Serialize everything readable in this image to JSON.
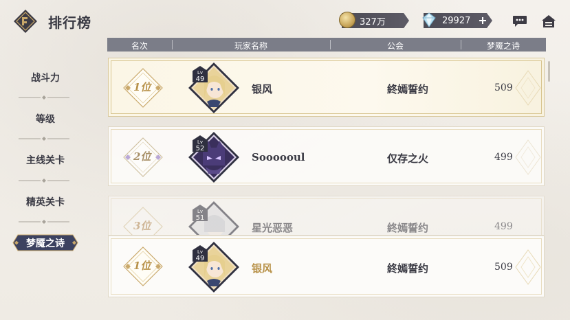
{
  "header": {
    "title": "排行榜",
    "gold_amount": "327万",
    "gem_amount": "29927"
  },
  "nav": {
    "items": [
      {
        "label": "战斗力"
      },
      {
        "label": "等级"
      },
      {
        "label": "主线关卡"
      },
      {
        "label": "精英关卡"
      },
      {
        "label": "梦魇之诗"
      }
    ],
    "active_index": 4
  },
  "table": {
    "columns": [
      "名次",
      "玩家名称",
      "公会",
      "梦魇之诗"
    ]
  },
  "rows": [
    {
      "rank": "1位",
      "level_label": "Lv",
      "level": "49",
      "name": "银风",
      "guild": "終嫣誓约",
      "score": "509"
    },
    {
      "rank": "2位",
      "level_label": "Lv",
      "level": "52",
      "name": "Soooooul",
      "guild": "仅存之火",
      "score": "499"
    },
    {
      "rank": "3位",
      "level_label": "Lv",
      "level": "51",
      "name": "星光恶恶",
      "guild": "終嫣誓约",
      "score": "499"
    }
  ],
  "my_row": {
    "rank": "1位",
    "level_label": "Lv",
    "level": "49",
    "name": "银风",
    "guild": "終嫣誓约",
    "score": "509"
  },
  "colors": {
    "accent_gold": "#b8924a",
    "header_bar": "#7b7d88",
    "nav_active": "#3c4260"
  }
}
